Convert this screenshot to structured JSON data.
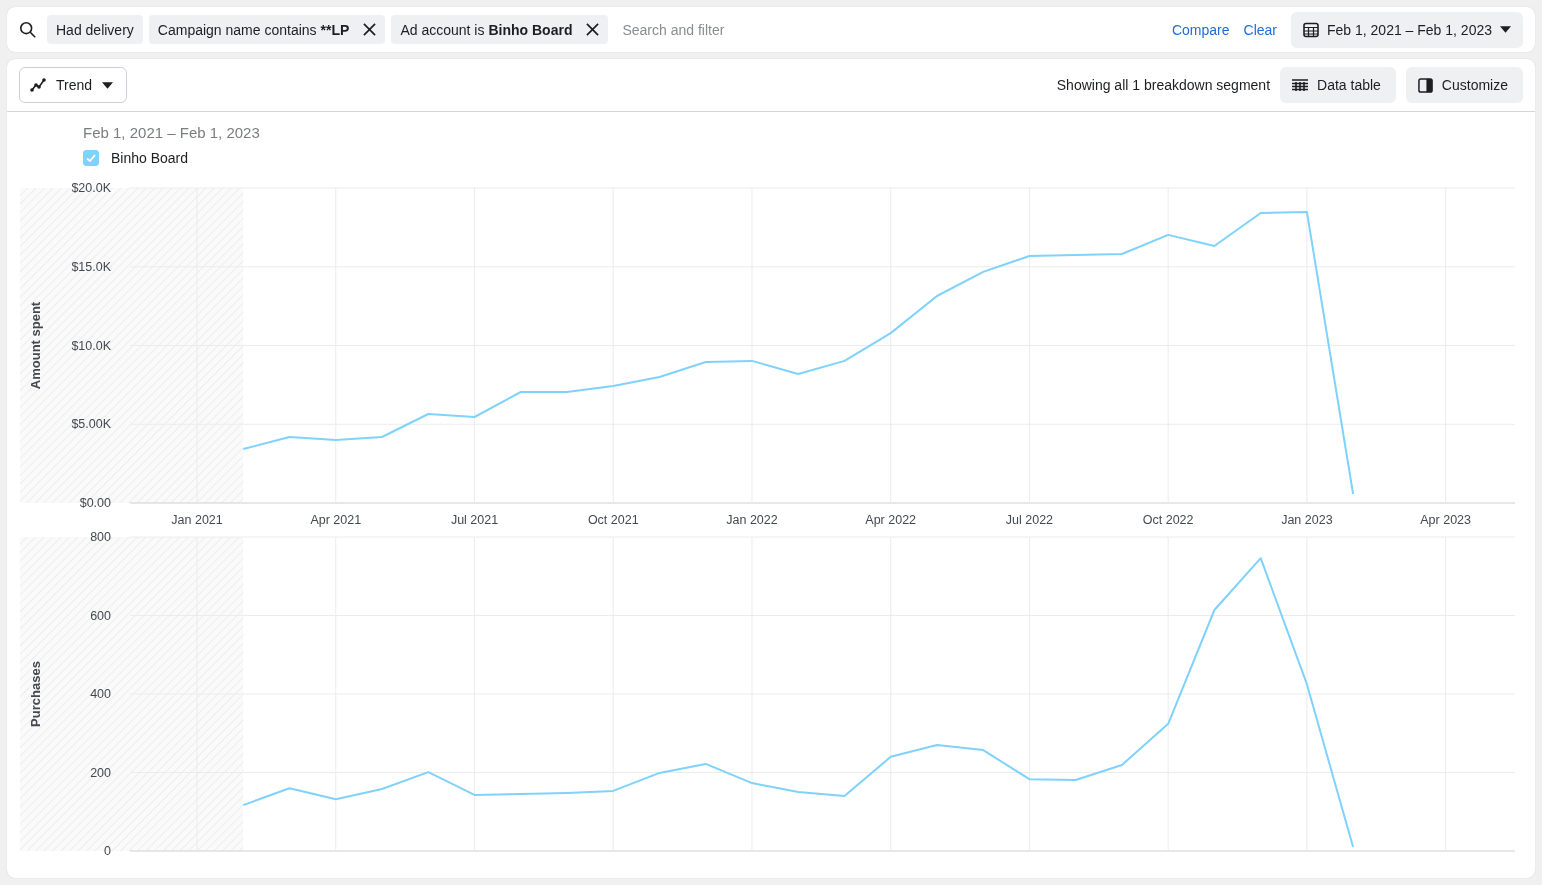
{
  "filter_bar": {
    "chips": [
      {
        "label": "Had delivery",
        "removable": false
      },
      {
        "label": "Campaign name contains",
        "value": "**LP",
        "removable": true
      },
      {
        "label": "Ad account is",
        "value": "Binho Board",
        "removable": true
      }
    ],
    "search": {
      "placeholder": "Search and filter"
    },
    "links": [
      "Compare",
      "Clear"
    ],
    "date_range": "Feb 1, 2021 – Feb 1, 2023"
  },
  "toolbar": {
    "view_menu": "Trend",
    "segment_info": "Showing all 1 breakdown segment",
    "buttons": [
      {
        "kind": "table",
        "label": "Data table"
      },
      {
        "kind": "customize",
        "label": "Customize"
      }
    ]
  },
  "legend": {
    "date_range": "Feb 1, 2021 – Feb 1, 2023",
    "items": [
      {
        "label": "Binho Board",
        "checked": true,
        "color": "#7fd2fb"
      }
    ]
  },
  "charts": [
    {
      "chart_data": {
        "type": "line",
        "ylabel": "Amount spent",
        "categories": [
          "Jan 2021",
          null,
          null,
          "Apr 2021",
          null,
          null,
          "Jul 2021",
          null,
          null,
          "Oct 2021",
          null,
          null,
          "Jan 2022",
          null,
          null,
          "Apr 2022",
          null,
          null,
          "Jul 2022",
          null,
          null,
          "Oct 2022",
          null,
          null,
          "Jan 2023",
          null,
          null,
          "Apr 2023"
        ],
        "series": [
          {
            "color": "#7fd2fb",
            "values": [
              null,
              3430,
              4190,
              4000,
              4190,
              5650,
              5460,
              7050,
              7050,
              7430,
              8000,
              8950,
              9020,
              8190,
              9020,
              10790,
              13140,
              14670,
              15680,
              15750,
              15810,
              17020,
              16320,
              18410,
              18480,
              570,
              null,
              null
            ]
          }
        ],
        "grid": true,
        "ylim": [
          0,
          20000
        ],
        "yticks": [
          {
            "value": 0,
            "label": "$0.00"
          },
          {
            "value": 5000,
            "label": "$5.00K"
          },
          {
            "value": 10000,
            "label": "$10.0K"
          },
          {
            "value": 15000,
            "label": "$15.0K"
          },
          {
            "value": 20000,
            "label": "$20.0K"
          }
        ]
      }
    },
    {
      "chart_data": {
        "type": "line",
        "ylabel": "Purchases",
        "categories": [
          null,
          null,
          null,
          null,
          null,
          null,
          null,
          null,
          null,
          null,
          null,
          null,
          null,
          null,
          null,
          null,
          null,
          null,
          null,
          null,
          null,
          null,
          null,
          null,
          null,
          null,
          null,
          null
        ],
        "series": [
          {
            "color": "#7fd2fb",
            "values": [
              null,
              117,
              160,
              132,
              158,
              201,
              143,
              145,
              148,
              153,
              199,
              222,
              173,
              150,
              140,
              240,
              270,
              257,
              183,
              181,
              219,
              324,
              614,
              746,
              425,
              10,
              null,
              null
            ]
          }
        ],
        "grid": true,
        "ylim": [
          0,
          800
        ],
        "yticks": [
          {
            "value": 0,
            "label": "0"
          },
          {
            "value": 200,
            "label": "200"
          },
          {
            "value": 400,
            "label": "400"
          },
          {
            "value": 600,
            "label": "600"
          },
          {
            "value": 800,
            "label": "800"
          }
        ]
      }
    }
  ]
}
